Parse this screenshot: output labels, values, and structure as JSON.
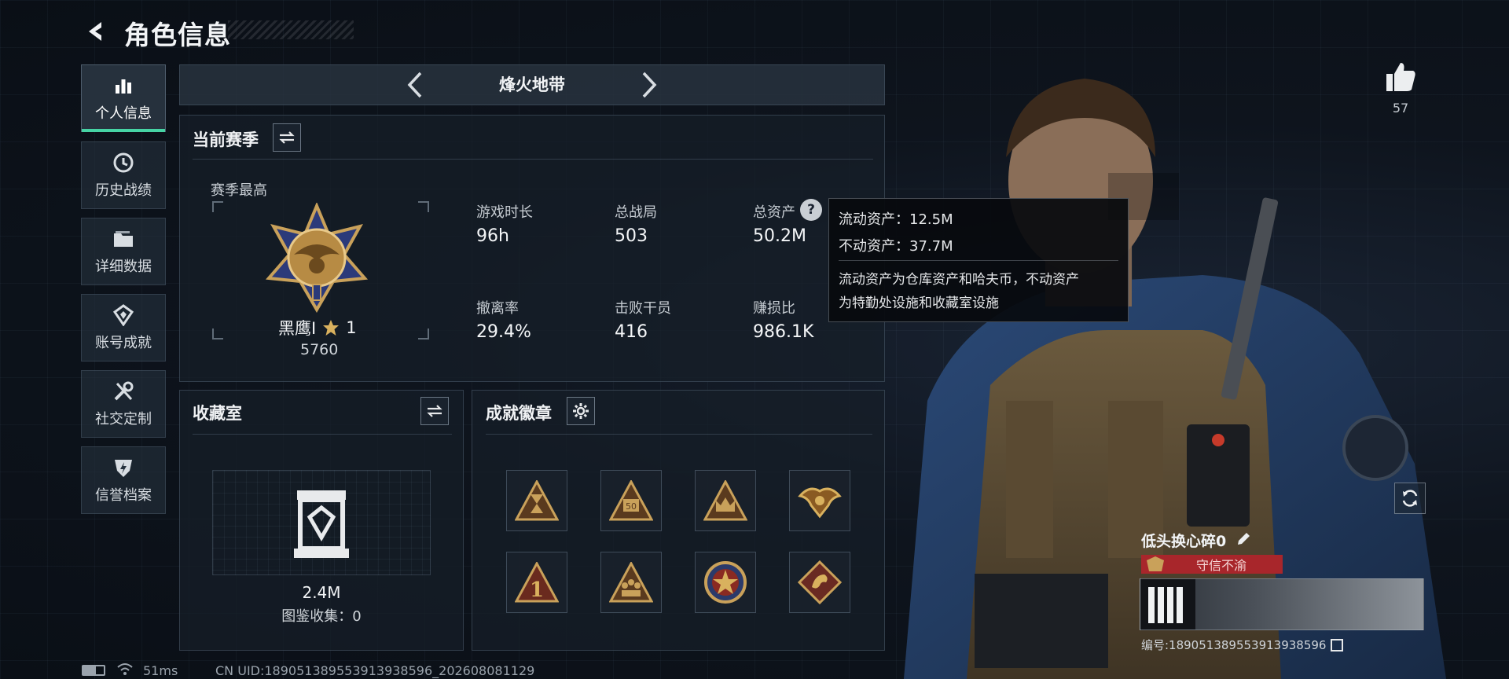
{
  "header": {
    "title": "角色信息"
  },
  "nav": {
    "items": [
      {
        "label": "个人信息",
        "icon": "bar-chart-icon",
        "active": true
      },
      {
        "label": "历史战绩",
        "icon": "history-clock-icon",
        "active": false
      },
      {
        "label": "详细数据",
        "icon": "folder-icon",
        "active": false
      },
      {
        "label": "账号成就",
        "icon": "medal-icon",
        "active": false
      },
      {
        "label": "社交定制",
        "icon": "tools-icon",
        "active": false
      },
      {
        "label": "信誉档案",
        "icon": "shield-bolt-icon",
        "active": false
      }
    ]
  },
  "mode": {
    "title": "烽火地带"
  },
  "season": {
    "title": "当前赛季",
    "best_label": "赛季最高",
    "rank_name": "黑鹰I",
    "rank_stars": "1",
    "rank_points": "5760",
    "stats": [
      {
        "label": "游戏时长",
        "value": "96h"
      },
      {
        "label": "总战局",
        "value": "503"
      },
      {
        "label": "总资产",
        "value": "50.2M"
      },
      {
        "label": "撤离率",
        "value": "29.4%"
      },
      {
        "label": "击败干员",
        "value": "416"
      },
      {
        "label": "赚损比",
        "value": "986.1K"
      }
    ]
  },
  "tooltip": {
    "liquid": "流动资产：12.5M",
    "fixed": "不动资产：37.7M",
    "desc_line1": "流动资产为仓库资产和哈夫币，不动资产",
    "desc_line2": "为特勤处设施和收藏室设施"
  },
  "collection": {
    "title": "收藏室",
    "value": "2.4M",
    "catalog": "图鉴收集：0"
  },
  "achievements": {
    "title": "成就徽章",
    "badges": [
      {
        "icon": "hourglass-badge-icon",
        "mark": ""
      },
      {
        "icon": "fifty-badge-icon",
        "mark": "50"
      },
      {
        "icon": "crown-badge-icon",
        "mark": ""
      },
      {
        "icon": "phoenix-badge-icon",
        "mark": ""
      },
      {
        "icon": "number-one-badge-icon",
        "mark": "1"
      },
      {
        "icon": "squad-badge-icon",
        "mark": ""
      },
      {
        "icon": "star-circle-badge-icon",
        "mark": ""
      },
      {
        "icon": "dragon-badge-icon",
        "mark": ""
      }
    ]
  },
  "profile": {
    "likes": "57",
    "name": "低头换心碎0",
    "honor": "守信不渝",
    "id_line": "编号:18905138955391393859​6"
  },
  "status": {
    "latency": "51ms",
    "uid": "CN UID:18905138955391393859​6_202608081129"
  },
  "colors": {
    "accent": "#46d3a4",
    "honor_red": "#a8262b",
    "gold": "#c9a15a"
  }
}
